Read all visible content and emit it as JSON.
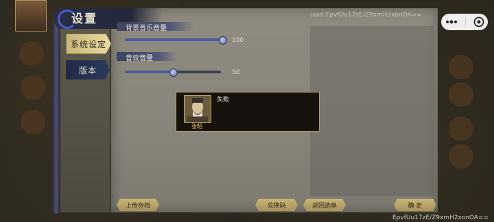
{
  "title": "设置",
  "sidebar": {
    "tabs": [
      {
        "label": "系统设定",
        "active": true
      },
      {
        "label": "版本",
        "active": false
      }
    ]
  },
  "settings": {
    "music": {
      "label": "背景音乐音量",
      "value": 100
    },
    "sfx": {
      "label": "音效音量",
      "value": 50
    }
  },
  "uuid_text": "uuid:EpvfUu17zE/Z9xmH2xonOA==",
  "popup": {
    "message": "失败",
    "character_name": "张昭"
  },
  "buttons": {
    "upload": "上传存档",
    "redeem": "兑换码",
    "back": "返回选单",
    "confirm": "确 定"
  },
  "footer_id": "EpvfUu17zE/Z9xmH2xonOA==",
  "colors": {
    "accent_gold": "#c8b579",
    "popup_bg": "#15110c",
    "slider_fill": "#4a5d9a",
    "name_gold": "#e8c46a"
  },
  "icons": [
    "more-icon",
    "close-circle-icon",
    "swirl-icon",
    "portrait-icon"
  ]
}
